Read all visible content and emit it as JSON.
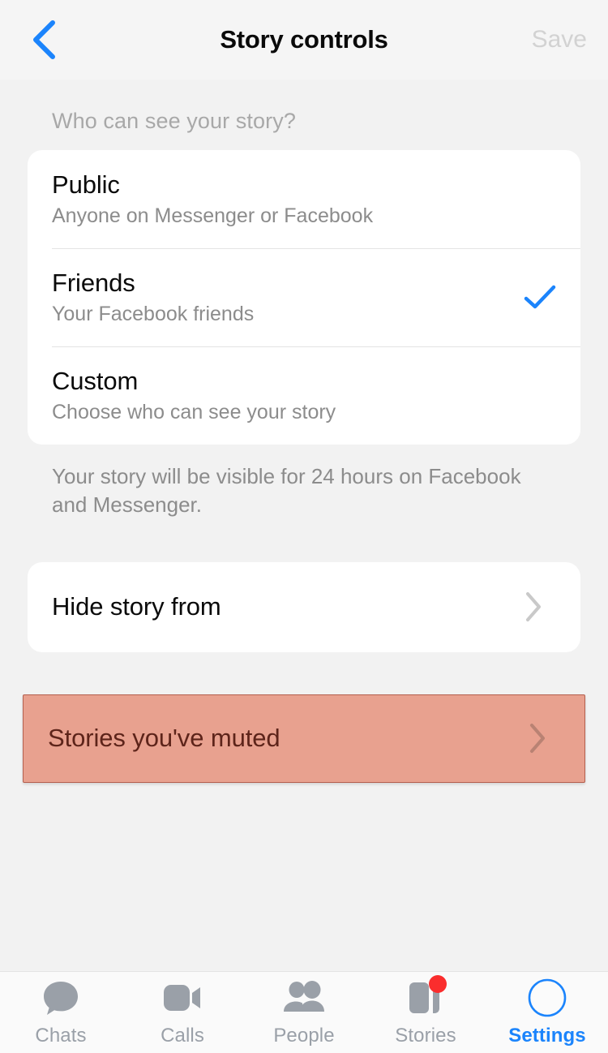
{
  "header": {
    "back_icon": "chevron-left-icon",
    "title": "Story controls",
    "save_label": "Save",
    "save_color": "#d2d2d2",
    "accent_color": "#1b84fc"
  },
  "section": {
    "title": "Who can see your story?",
    "options": [
      {
        "title": "Public",
        "subtitle": "Anyone on Messenger or Facebook",
        "selected": false
      },
      {
        "title": "Friends",
        "subtitle": "Your Facebook friends",
        "selected": true
      },
      {
        "title": "Custom",
        "subtitle": "Choose who can see your story",
        "selected": false
      }
    ],
    "note": "Your story will be visible for 24 hours on Facebook and Messenger.",
    "check_icon": "check-icon",
    "check_color": "#1b84fc"
  },
  "links": [
    {
      "label": "Hide story from",
      "chevron_icon": "chevron-right-icon",
      "highlighted": false
    },
    {
      "label": "Stories you've muted",
      "chevron_icon": "chevron-right-icon",
      "highlighted": true,
      "highlight_fill": "#e8a18f",
      "highlight_border": "#b4604f"
    }
  ],
  "tabbar": {
    "items": [
      {
        "label": "Chats",
        "icon": "speech-bubble-icon",
        "active": false,
        "badge": false
      },
      {
        "label": "Calls",
        "icon": "video-camera-icon",
        "active": false,
        "badge": false
      },
      {
        "label": "People",
        "icon": "people-icon",
        "active": false,
        "badge": false
      },
      {
        "label": "Stories",
        "icon": "stories-icon",
        "active": false,
        "badge": true
      },
      {
        "label": "Settings",
        "icon": "avatar-circle-icon",
        "active": true,
        "badge": false
      }
    ],
    "inactive_color": "#9aa0a8",
    "active_color": "#1b84fc",
    "badge_color": "#fa2d2d"
  }
}
